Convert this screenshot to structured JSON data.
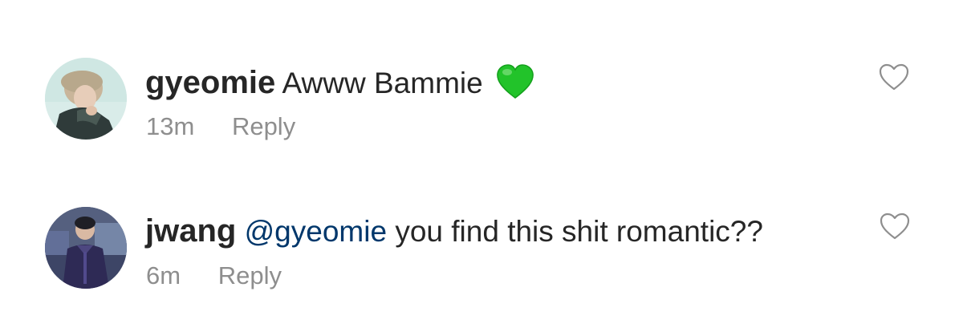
{
  "comments": [
    {
      "username": "gyeomie",
      "mention": "",
      "text": "Awww Bammie",
      "emoji": "green-heart",
      "time": "13m",
      "reply_label": "Reply"
    },
    {
      "username": "jwang",
      "mention": "@gyeomie",
      "text": "you find this shit romantic??",
      "time": "6m",
      "reply_label": "Reply"
    }
  ],
  "icons": {
    "like": "heart-outline-icon",
    "emoji": "green-heart-icon"
  },
  "colors": {
    "text": "#262626",
    "secondary": "#8e8e8e",
    "mention": "#00376b",
    "emoji_green": "#22c32a"
  }
}
